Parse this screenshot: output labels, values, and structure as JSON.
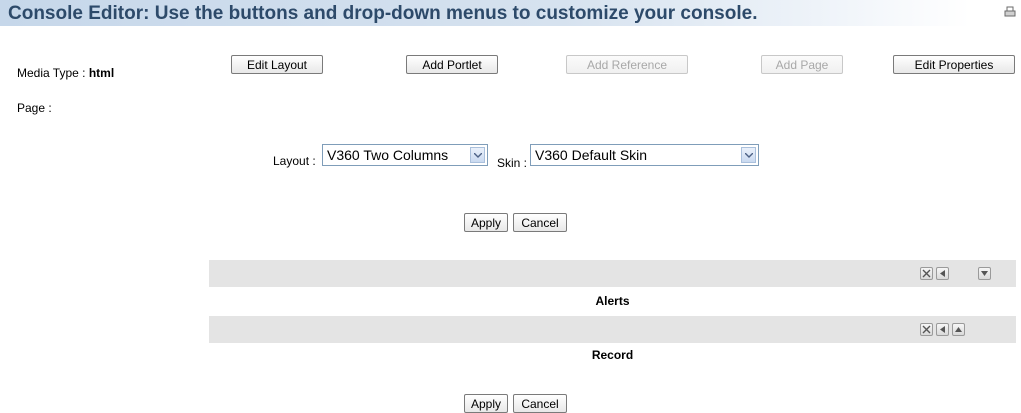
{
  "header": {
    "title": "Console Editor: Use the buttons and drop-down menus to customize your console."
  },
  "info": {
    "media_type_label": "Media Type : ",
    "media_type_value": "html",
    "page_label": "Page :"
  },
  "toolbar": {
    "edit_layout": "Edit Layout",
    "add_portlet": "Add Portlet",
    "add_reference": "Add Reference",
    "add_page": "Add Page",
    "edit_properties": "Edit Properties"
  },
  "form": {
    "layout_label": "Layout :",
    "layout_value": "V360 Two Columns",
    "skin_label": "Skin :",
    "skin_value": "V360 Default Skin"
  },
  "actions": {
    "apply": "Apply",
    "cancel": "Cancel"
  },
  "portlets": [
    {
      "label": "Alerts"
    },
    {
      "label": "Record"
    }
  ],
  "colors": {
    "title_text": "#2d4a6a",
    "title_bar": "#c6d7ea",
    "portlet_bar": "#e4e4e4"
  }
}
